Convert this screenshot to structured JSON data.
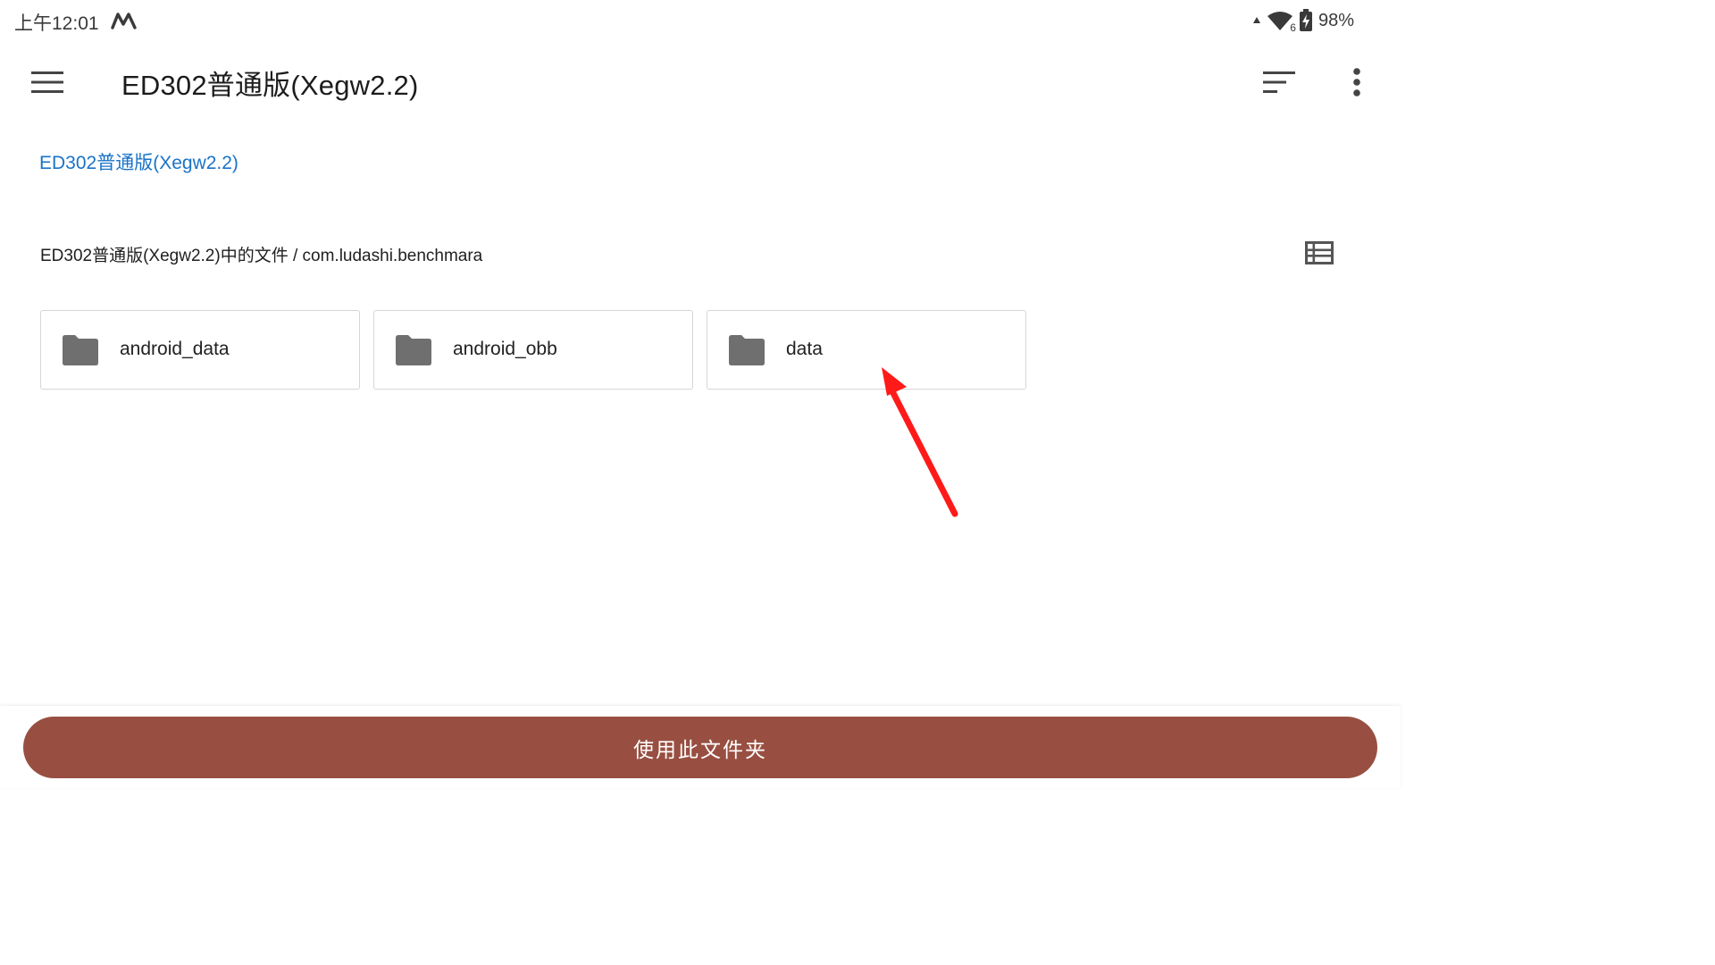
{
  "status_bar": {
    "time": "上午12:01",
    "notification_icon": "m-logo-icon",
    "wifi_badge": "6",
    "battery": "98%"
  },
  "app_bar": {
    "title": "ED302普通版(Xegw2.2)",
    "menu_icon": "hamburger-menu-icon",
    "sort_icon": "sort-icon",
    "overflow_icon": "more-vert-icon"
  },
  "root_link": "ED302普通版(Xegw2.2)",
  "breadcrumb": "ED302普通版(Xegw2.2)中的文件 / com.ludashi.benchmara",
  "view_toggle_icon": "list-view-icon",
  "folders": [
    {
      "name": "android_data",
      "icon": "folder-icon"
    },
    {
      "name": "android_obb",
      "icon": "folder-icon"
    },
    {
      "name": "data",
      "icon": "folder-icon"
    }
  ],
  "bottom_button": {
    "label": "使用此文件夹"
  },
  "colors": {
    "accent_link": "#1a73c8",
    "button_bg": "#984f41",
    "folder_icon": "#6f6f6f",
    "annotation_arrow": "#ff1a1a"
  }
}
